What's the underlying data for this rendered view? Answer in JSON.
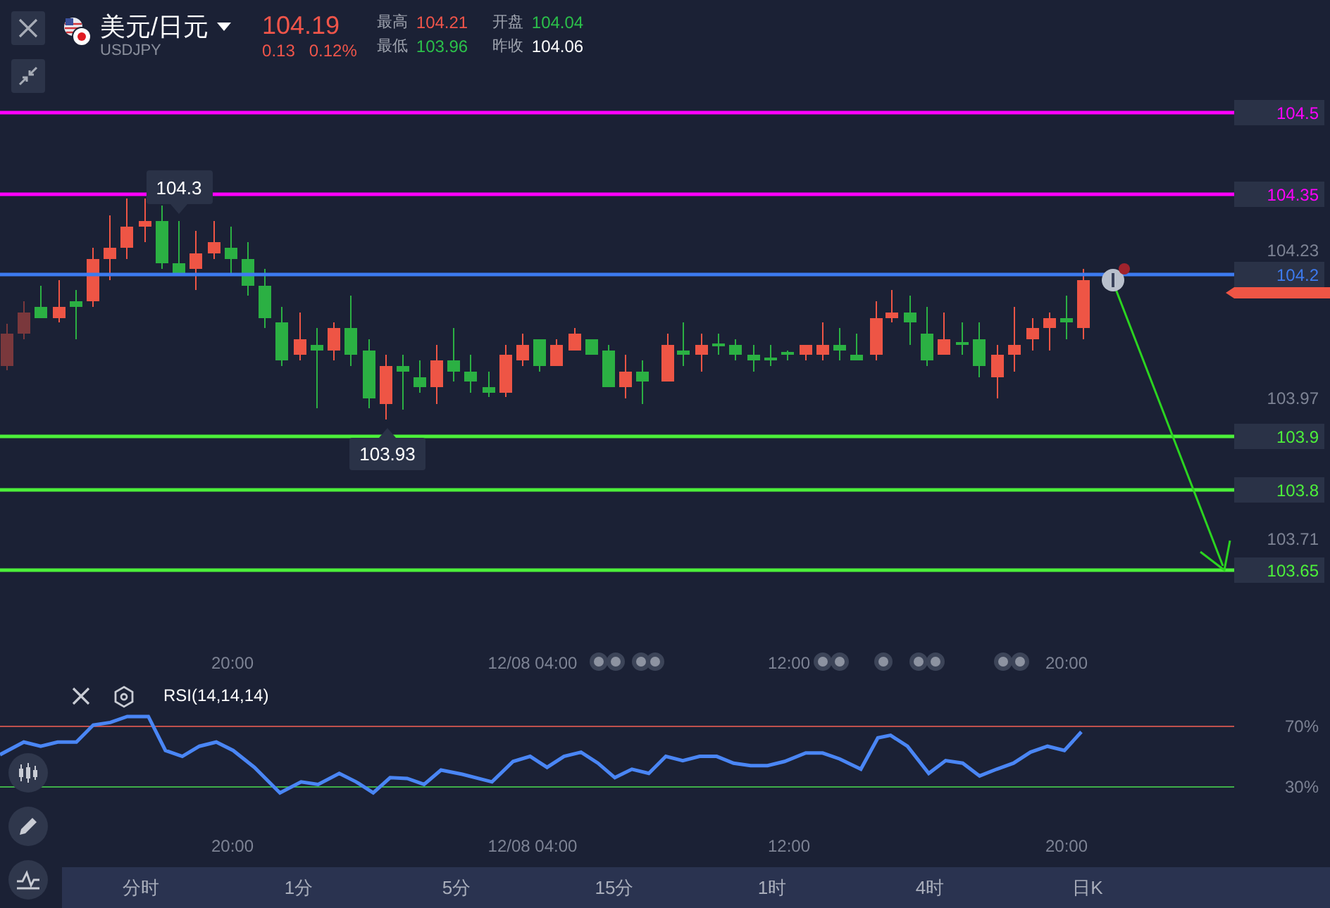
{
  "header": {
    "pair": "美元/日元",
    "symbol": "USDJPY",
    "price": "104.19",
    "change": "0.13",
    "change_pct": "0.12%",
    "stats": [
      {
        "label": "最高",
        "value": "104.21",
        "color": "#f0554a"
      },
      {
        "label": "开盘",
        "value": "104.04",
        "color": "#2bc04a"
      },
      {
        "label": "最低",
        "value": "103.96",
        "color": "#2bc04a"
      },
      {
        "label": "昨收",
        "value": "104.06",
        "color": "#ffffff"
      }
    ]
  },
  "chart": {
    "levels": [
      {
        "label": "104.5",
        "color": "#ff00ff"
      },
      {
        "label": "104.35",
        "color": "#ff00ff"
      },
      {
        "label": "104.2",
        "color": "#3d7bf0"
      },
      {
        "label": "103.9",
        "color": "#4cf03a"
      },
      {
        "label": "103.8",
        "color": "#4cf03a"
      },
      {
        "label": "103.65",
        "color": "#4cf03a"
      }
    ],
    "axis_ticks": [
      "104.23",
      "103.97",
      "103.71"
    ],
    "callouts": [
      "104.3",
      "103.93"
    ],
    "time_labels": [
      "20:00",
      "12/08 04:00",
      "12:00",
      "20:00"
    ]
  },
  "rsi": {
    "title": "RSI(14,14,14)",
    "upper": "70%",
    "lower": "30%",
    "time_labels": [
      "20:00",
      "12/08 04:00",
      "12:00",
      "20:00"
    ]
  },
  "timeframes": [
    {
      "label": "分时",
      "selected": false
    },
    {
      "label": "1分",
      "selected": false
    },
    {
      "label": "5分",
      "selected": false
    },
    {
      "label": "15分",
      "selected": false
    },
    {
      "label": "1时",
      "selected": false
    },
    {
      "label": "4时",
      "selected": false
    },
    {
      "label": "日K",
      "selected": false
    }
  ]
}
